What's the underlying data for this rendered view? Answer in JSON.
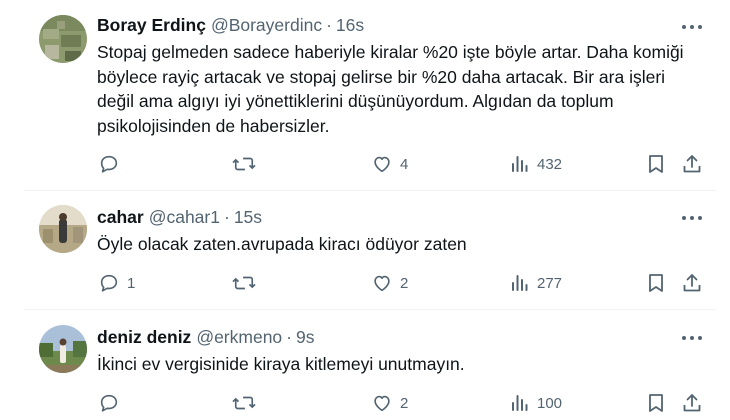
{
  "tweets": [
    {
      "name": "Boray Erdinç",
      "handle": "@Borayerdinc",
      "dot": "·",
      "time": "16s",
      "text_lines": [
        "Stopaj gelmeden sadece haberiyle kiralar %20 işte böyle artar. Daha komiği",
        "böylece rayiç artacak ve stopaj gelirse bir %20 daha artacak. Bir ara işleri",
        "değil ama algıyı iyi yönettiklerini düşünüyordum. Algıdan da toplum",
        "psikolojisinden de habersizler."
      ],
      "replies": "",
      "retweets": "",
      "likes": "4",
      "views": "432",
      "icons": [
        "reply-icon",
        "retweet-icon",
        "like-icon",
        "views-icon",
        "bookmark-icon",
        "share-icon"
      ]
    },
    {
      "name": "cahar",
      "handle": "@cahar1",
      "dot": "·",
      "time": "15s",
      "text_lines": [
        "Öyle olacak zaten.avrupada kiracı ödüyor zaten"
      ],
      "replies": "1",
      "retweets": "",
      "likes": "2",
      "views": "277",
      "icons": [
        "reply-icon",
        "retweet-icon",
        "like-icon",
        "views-icon",
        "bookmark-icon",
        "share-icon"
      ]
    },
    {
      "name": "deniz deniz",
      "handle": "@erkmeno",
      "dot": "·",
      "time": "9s",
      "text_lines": [
        "İkinci ev vergisinide kiraya kitlemeyi unutmayın."
      ],
      "replies": "",
      "retweets": "",
      "likes": "2",
      "views": "100",
      "icons": [
        "reply-icon",
        "retweet-icon",
        "like-icon",
        "views-icon",
        "bookmark-icon",
        "share-icon"
      ]
    }
  ],
  "colors": {
    "text_primary": "#0f1419",
    "text_secondary": "#536471",
    "divider": "#eff3f4"
  }
}
